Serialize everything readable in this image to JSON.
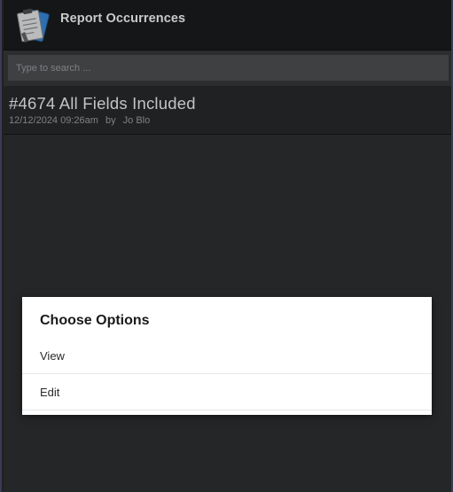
{
  "header": {
    "title": "Report Occurrences",
    "logo_icon": "report-clipboard-icon"
  },
  "search": {
    "placeholder": "Type to search ...",
    "value": ""
  },
  "occurrences": [
    {
      "title": "#4674 All Fields Included",
      "date": "12/12/2024 09:26am",
      "by_label": "by",
      "author": "Jo Blo"
    }
  ],
  "dialog": {
    "title": "Choose Options",
    "options": [
      "View",
      "Edit"
    ]
  },
  "colors": {
    "background": "#1f2123",
    "header": "#141617",
    "dialog": "#ffffff"
  }
}
